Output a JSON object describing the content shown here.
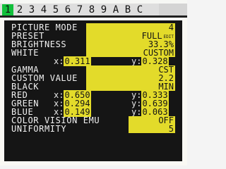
{
  "tabs": [
    {
      "label": "1",
      "active": true
    },
    {
      "label": "2",
      "active": false
    },
    {
      "label": "3",
      "active": false
    },
    {
      "label": "4",
      "active": false
    },
    {
      "label": "5",
      "active": false
    },
    {
      "label": "6",
      "active": false
    },
    {
      "label": "7",
      "active": false
    },
    {
      "label": "8",
      "active": false
    },
    {
      "label": "9",
      "active": false
    },
    {
      "label": "A",
      "active": false
    },
    {
      "label": "B",
      "active": false
    },
    {
      "label": "C",
      "active": false
    }
  ],
  "menu": {
    "picture_mode": {
      "label": "PICTURE MODE",
      "value": "4"
    },
    "preset": {
      "label": "PRESET",
      "value": "FULL",
      "tag": "EDIT"
    },
    "brightness": {
      "label": "BRIGHTNESS",
      "value": "33.3%"
    },
    "white": {
      "label": "WHITE",
      "value": "CUSTOM",
      "x": "0.311",
      "y": "0.328"
    },
    "gamma": {
      "label": "GAMMA",
      "value": "CST"
    },
    "custom_value": {
      "label": "CUSTOM VALUE",
      "value": "2.2"
    },
    "black": {
      "label": "BLACK",
      "value": "MIN"
    },
    "red": {
      "label": "RED",
      "x": "0.650",
      "y": "0.333"
    },
    "green": {
      "label": "GREEN",
      "x": "0.294",
      "y": "0.639"
    },
    "blue": {
      "label": "BLUE",
      "x": "0.149",
      "y": "0.063"
    },
    "color_vision_emu": {
      "label": "COLOR VISION EMU",
      "value": "OFF"
    },
    "uniformity": {
      "label": "UNIFORMITY",
      "value": "5"
    }
  },
  "coord_labels": {
    "x": "x:",
    "y": "y:"
  },
  "colors": {
    "active_tab": "#12c03c",
    "value_highlight": "#e3db2a",
    "osd_background": "#151515"
  }
}
